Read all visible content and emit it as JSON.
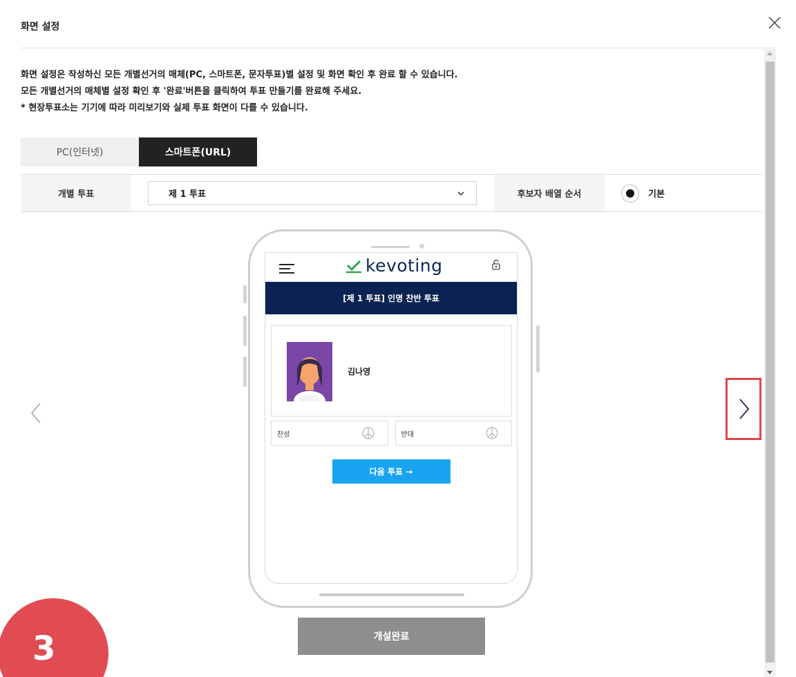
{
  "dialog": {
    "title": "화면 설정",
    "description": [
      "화면 설정은 작성하신 모든 개별선거의 매체(PC, 스마트폰, 문자투표)별 설정 및 화면 확인 후 완료 할 수 있습니다.",
      "모든 개별선거의 매체별 설정 확인 후 '완료'버튼을 클릭하여 투표 만들기를 완료해 주세요.",
      "* 현장투표소는 기기에 따라 미리보기와 실제 투표 화면이 다를 수 있습니다."
    ]
  },
  "tabs": [
    {
      "label": "PC(인터넷)",
      "active": false
    },
    {
      "label": "스마트폰(URL)",
      "active": true
    }
  ],
  "settings": {
    "vote_label": "개별 투표",
    "vote_selected": "제 1 투표",
    "order_label": "후보자 배열 순서",
    "order_option": "기본"
  },
  "preview": {
    "logo_text": "kevoting",
    "vote_title": "[제 1 투표] 인명 찬반 투표",
    "candidate_name": "김나영",
    "approve_label": "찬성",
    "reject_label": "반대",
    "next_button": "다음 투표  →"
  },
  "footer": {
    "finish_button": "개설완료"
  },
  "step_badge": "3",
  "colors": {
    "accent_navy": "#0b2252",
    "accent_blue": "#19a4f2",
    "highlight_red": "#e0454a",
    "badge_red": "#e04c52"
  }
}
